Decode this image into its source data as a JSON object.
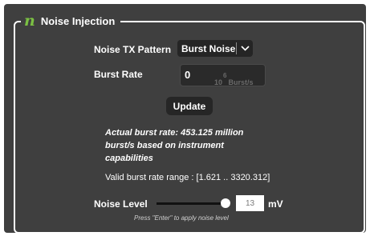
{
  "panel": {
    "title": "Noise Injection",
    "logo_text": "n"
  },
  "pattern": {
    "label": "Noise TX Pattern",
    "value": "Burst Noise"
  },
  "burst_rate": {
    "label": "Burst Rate",
    "value": "0",
    "unit_prefix": "10",
    "unit_exp": "6",
    "unit_suffix": "Burst/s"
  },
  "update_label": "Update",
  "actual_rate_text": "Actual burst rate: 453.125 million burst/s based on instrument capabilities",
  "range_text": "Valid burst rate range : [1.621 .. 3320.312]",
  "noise_level": {
    "label": "Noise Level",
    "value": "13",
    "unit": "mV",
    "slider_fraction": 1.0
  },
  "hint": "Press \"Enter\" to apply noise level",
  "colors": {
    "panel_bg": "#3f3f3f",
    "logo": "#7bc043",
    "control_bg": "#262626"
  },
  "icons": {
    "dropdown": "chevron-down-icon",
    "logo": "logo-icon"
  }
}
